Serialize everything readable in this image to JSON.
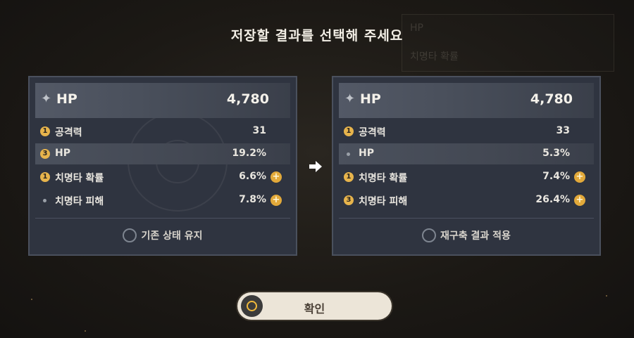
{
  "title": "저장할 결과를 선택해 주세요",
  "left": {
    "main_stat": {
      "name": "HP",
      "value": "4,780"
    },
    "substats": [
      {
        "badge": "1",
        "name": "공격력",
        "value": "31",
        "plus": false,
        "highlight": false
      },
      {
        "badge": "3",
        "name": "HP",
        "value": "19.2%",
        "plus": false,
        "highlight": true
      },
      {
        "badge": "1",
        "name": "치명타 확률",
        "value": "6.6%",
        "plus": true,
        "highlight": false
      },
      {
        "badge": "",
        "name": "치명타 피해",
        "value": "7.8%",
        "plus": true,
        "highlight": false
      }
    ],
    "choice_label": "기존 상태 유지"
  },
  "right": {
    "main_stat": {
      "name": "HP",
      "value": "4,780"
    },
    "substats": [
      {
        "badge": "1",
        "name": "공격력",
        "value": "33",
        "plus": false,
        "highlight": false
      },
      {
        "badge": "",
        "name": "HP",
        "value": "5.3%",
        "plus": false,
        "highlight": true
      },
      {
        "badge": "1",
        "name": "치명타 확률",
        "value": "7.4%",
        "plus": true,
        "highlight": false
      },
      {
        "badge": "3",
        "name": "치명타 피해",
        "value": "26.4%",
        "plus": true,
        "highlight": false
      }
    ],
    "choice_label": "재구축 결과 적용"
  },
  "confirm_label": "확인",
  "background_ghost": {
    "line1": "HP",
    "line2": "치명타 확률"
  },
  "icons": {
    "main": "sparkle-icon",
    "plus": "plus-circle-icon",
    "arrow": "arrow-right-icon",
    "confirm": "circle-button-icon"
  },
  "colors": {
    "badge": "#e7b44c",
    "plus": "#e2a93a",
    "panel": "#2f3440",
    "button": "#ece5d8"
  }
}
